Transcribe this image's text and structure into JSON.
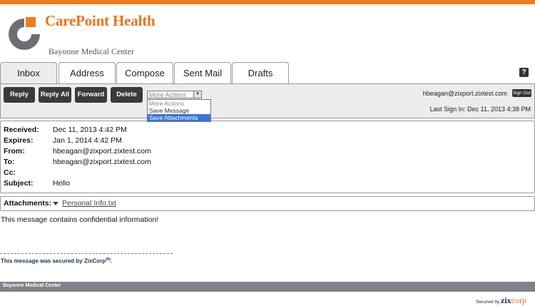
{
  "header": {
    "brand": "CarePoint Health",
    "subbrand": "Bayonne Medical Center",
    "logo_icon": "carepoint-logo-icon",
    "accent_color": "#f07c1c"
  },
  "tabs": [
    {
      "label": "Inbox",
      "active": true
    },
    {
      "label": "Address"
    },
    {
      "label": "Compose"
    },
    {
      "label": "Sent Mail"
    },
    {
      "label": "Drafts"
    }
  ],
  "help": {
    "label": "?"
  },
  "toolbar": {
    "reply": "Reply",
    "reply_all": "Reply All",
    "forward": "Forward",
    "delete": "Delete",
    "more_actions": {
      "selected": "More Actions",
      "options": [
        "More Actions",
        "Save Message",
        "Save Attachments"
      ],
      "highlighted": "Save Attachments"
    },
    "user_email": "hbeagan@zixport.zixtest.com",
    "sign_out": "Sign Out",
    "last_sign_in": "Last Sign In: Dec 11, 2013 4:38 PM"
  },
  "message": {
    "received_label": "Received:",
    "received": "Dec 11, 2013 4:42 PM",
    "expires_label": "Expires:",
    "expires": "Jan 1, 2014 4:42 PM",
    "from_label": "From:",
    "from": "hbeagan@zixport.zixtest.com",
    "to_label": "To:",
    "to": "hbeagan@zixport.zixtest.com",
    "cc_label": "Cc:",
    "cc": "",
    "subject_label": "Subject:",
    "subject": "Hello"
  },
  "attachments": {
    "label": "Attachments:",
    "file": "Personal Info.txt"
  },
  "body": "This message contains confidential information!",
  "secured_note": {
    "prefix": "This message was secured by ",
    "zix": "ZixCorp",
    "mark": "(R)",
    "suffix": "."
  },
  "footer": {
    "text": "Bayonne Medical Center"
  },
  "secured_by": {
    "prefix": "Secured by",
    "zix": "zix",
    "corp": "corp"
  }
}
